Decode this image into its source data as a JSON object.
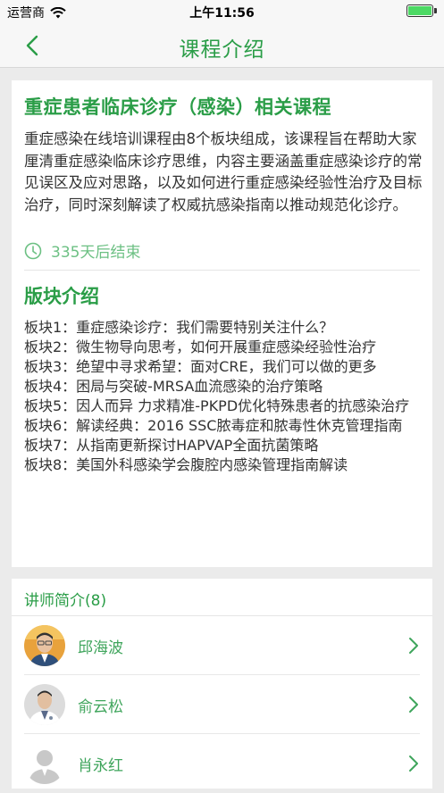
{
  "status_bar": {
    "carrier": "运营商",
    "time": "上午11:56",
    "battery_level": 1.0
  },
  "nav": {
    "title": "课程介绍",
    "back_icon": "chevron-left-icon"
  },
  "course": {
    "title": "重症患者临床诊疗（感染）相关课程",
    "description": "重症感染在线培训课程由8个板块组成，该课程旨在帮助大家厘清重症感染临床诊疗思维，内容主要涵盖重症感染诊疗的常见误区及应对思路，以及如何进行重症感染经验性治疗及目标治疗，同时深刻解读了权威抗感染指南以推动规范化诊疗。",
    "countdown": "335天后结束",
    "countdown_icon": "clock-icon"
  },
  "modules": {
    "title": "版块介绍",
    "items": [
      "板块1：重症感染诊疗：我们需要特别关注什么？",
      "板块2：微生物导向思考，如何开展重症感染经验性治疗",
      "板块3：绝望中寻求希望：面对CRE，我们可以做的更多",
      "板块4：困局与突破-MRSA血流感染的治疗策略",
      "板块5：因人而异 力求精准-PKPD优化特殊患者的抗感染治疗",
      "板块6：解读经典：2016 SSC脓毒症和脓毒性休克管理指南",
      "板块7：从指南更新探讨HAPVAP全面抗菌策略",
      "板块8：美国外科感染学会腹腔内感染管理指南解读"
    ]
  },
  "lecturers": {
    "header": "讲师简介(8)",
    "items": [
      {
        "name": "邱海波"
      },
      {
        "name": "俞云松"
      },
      {
        "name": "肖永红"
      }
    ]
  },
  "colors": {
    "accent": "#2a9d47",
    "accent_light": "#6cc083",
    "background": "#ebebeb"
  }
}
